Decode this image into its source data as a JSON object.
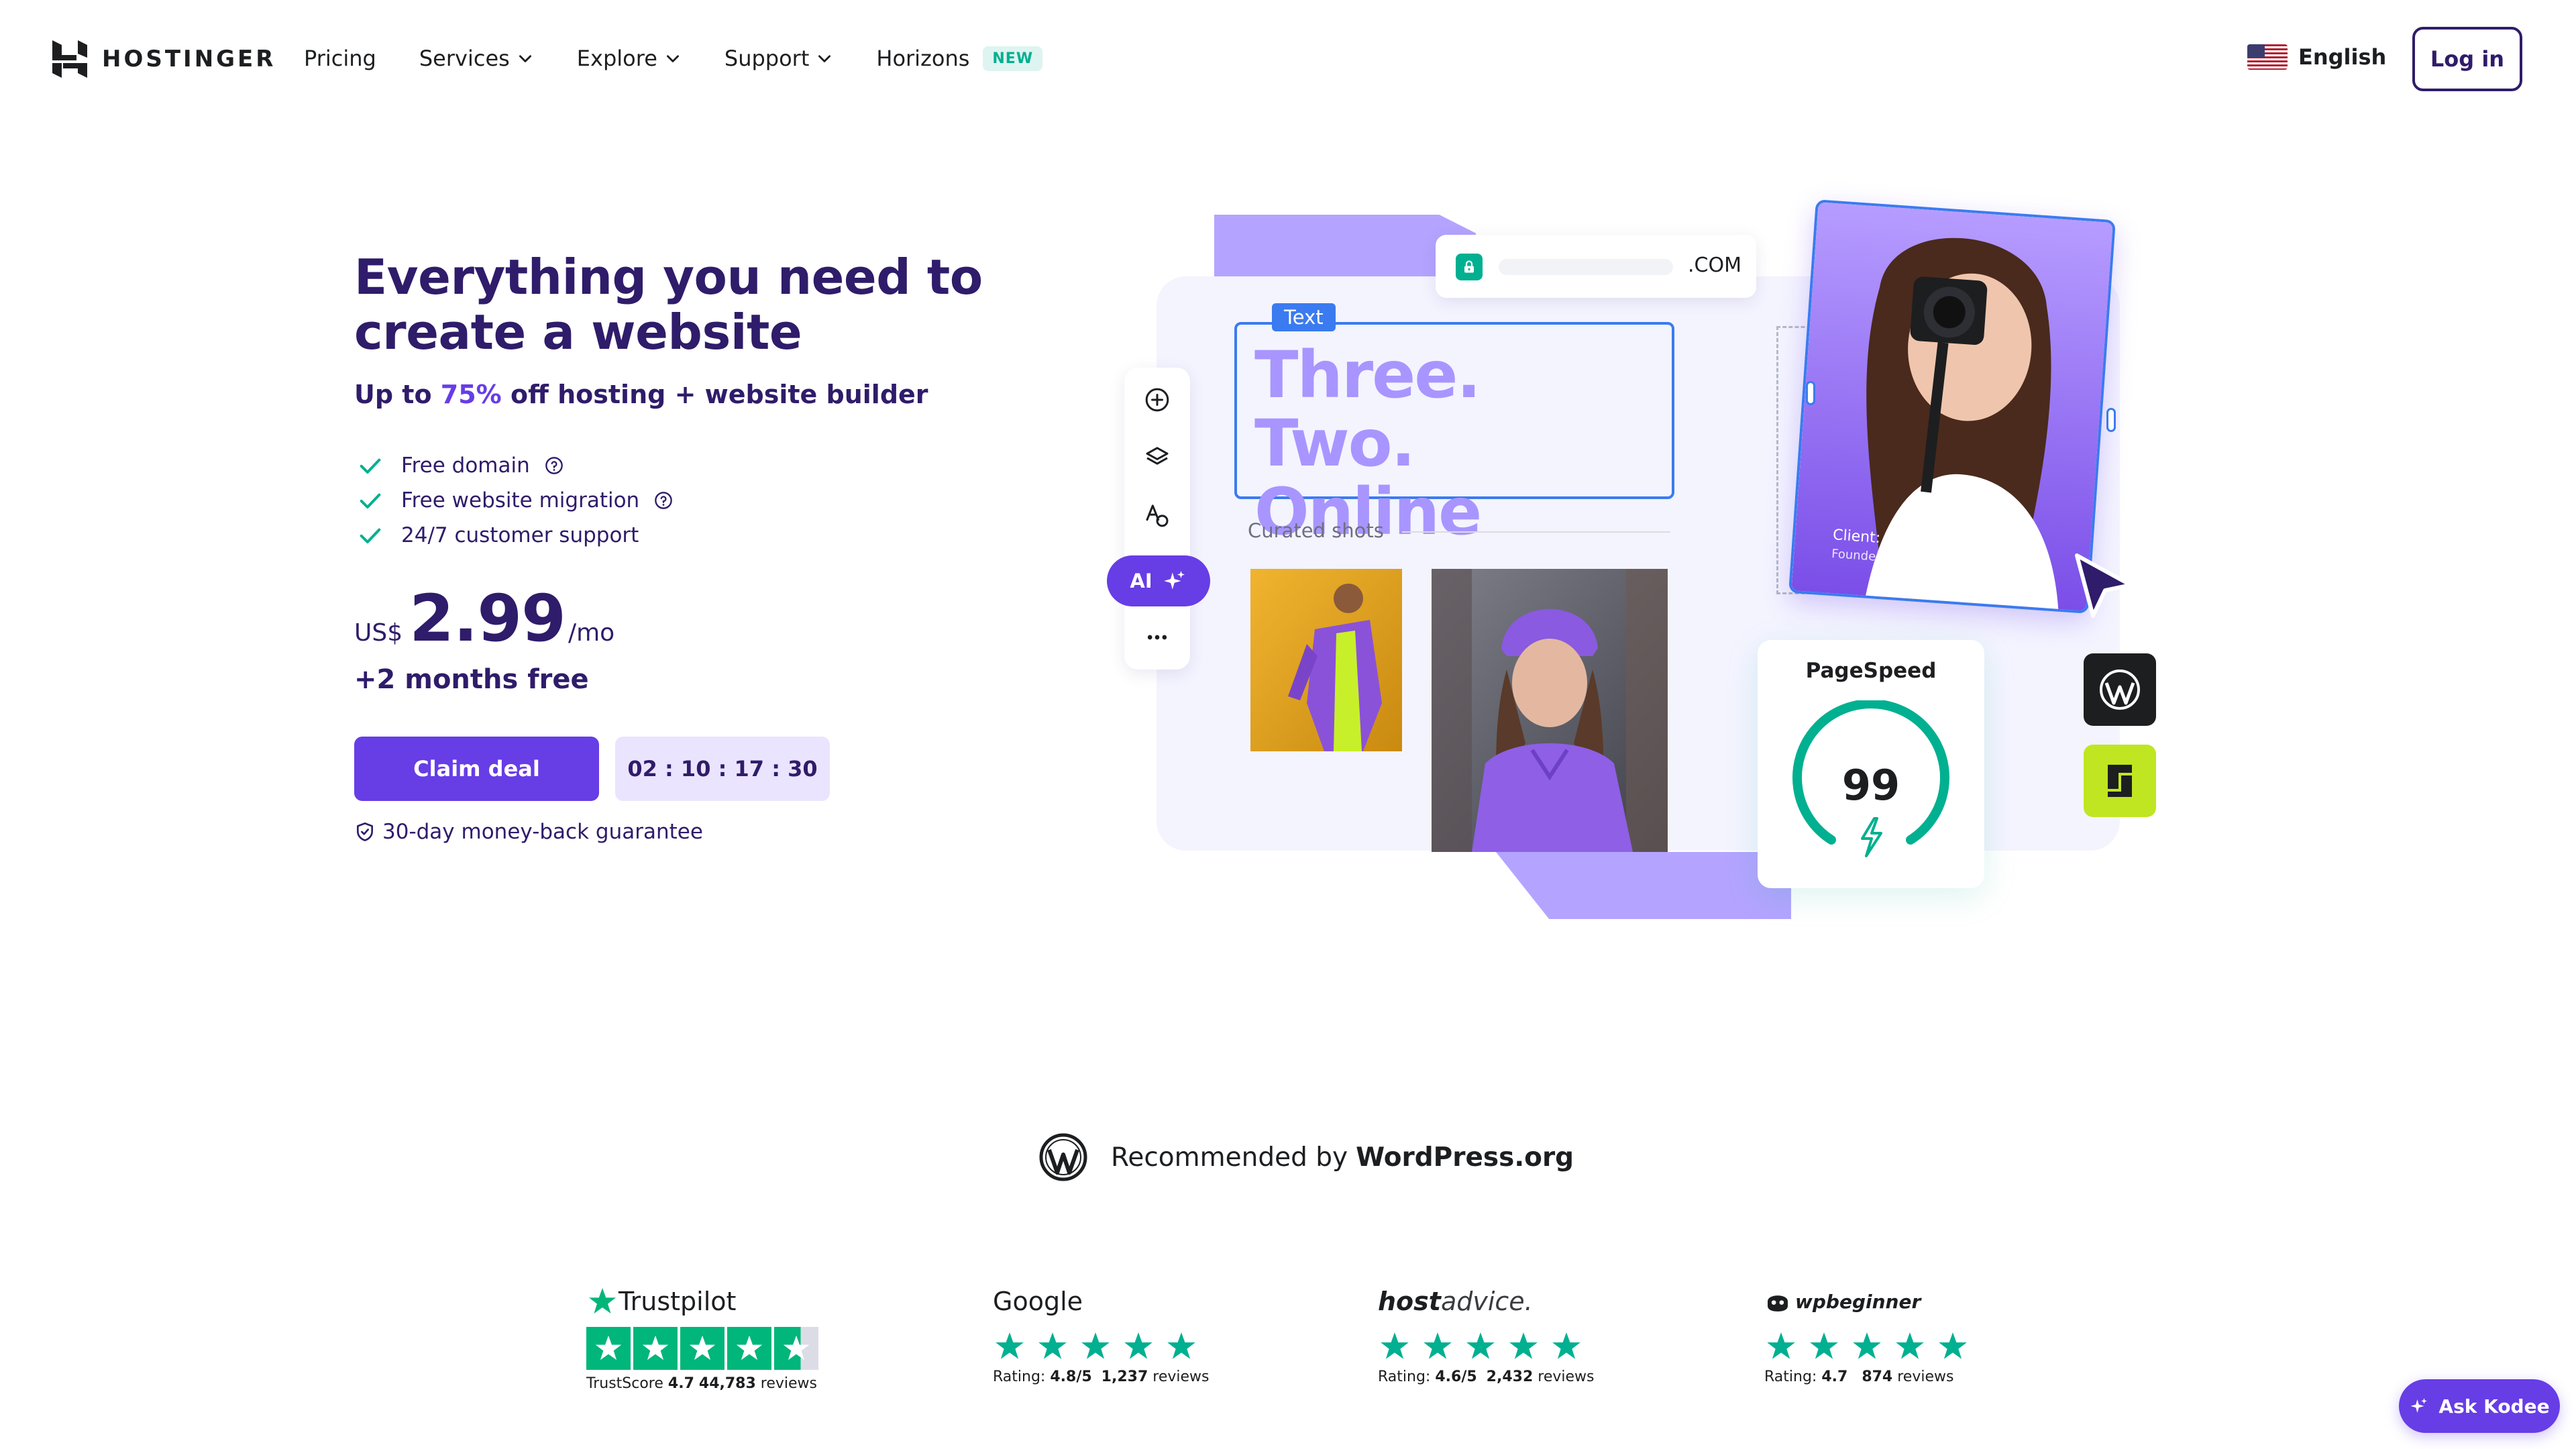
{
  "nav": {
    "brand": "HOSTINGER",
    "links": [
      {
        "label": "Pricing",
        "dropdown": false
      },
      {
        "label": "Services",
        "dropdown": true
      },
      {
        "label": "Explore",
        "dropdown": true
      },
      {
        "label": "Support",
        "dropdown": true
      },
      {
        "label": "Horizons",
        "dropdown": false,
        "badge": "NEW"
      }
    ],
    "language": "English",
    "login": "Log in"
  },
  "hero": {
    "title": "Everything you need to create a website",
    "subtitle_prefix": "Up to ",
    "subtitle_accent": "75%",
    "subtitle_suffix": " off hosting + website builder",
    "features": [
      {
        "label": "Free domain",
        "help": true
      },
      {
        "label": "Free website migration",
        "help": true
      },
      {
        "label": "24/7 customer support",
        "help": false
      }
    ],
    "currency": "US$",
    "price": "2.99",
    "period": "/mo",
    "bonus": "+2 months free",
    "cta": "Claim deal",
    "timer": "02 : 10 : 17 : 30",
    "guarantee": "30-day money-back guarantee"
  },
  "illustration": {
    "domain_tld": ".COM",
    "text_tag": "Text",
    "headline": "Three. Two. Online",
    "curated_label": "Curated shots",
    "ai_label": "AI",
    "portrait_caption": "Client: Anna Franques",
    "portrait_sub": "Founder of annafranques.com",
    "pagespeed_title": "PageSpeed",
    "pagespeed_score": "99",
    "pagespeed_level": 0.99
  },
  "recommended": {
    "prefix": "Recommended by",
    "strong": "WordPress.org"
  },
  "ratings": [
    {
      "source": "Trustpilot",
      "label": "TrustScore",
      "score": "4.7",
      "count": "44,783",
      "unit": "reviews",
      "stars": 4.5
    },
    {
      "source": "Google",
      "label": "Rating:",
      "score": "4.8/5",
      "count": "1,237",
      "unit": "reviews",
      "stars": 5
    },
    {
      "source_bold": "host",
      "source_light": "advice.",
      "label": "Rating:",
      "score": "4.6/5",
      "count": "2,432",
      "unit": "reviews",
      "stars": 5
    },
    {
      "source": "wpbeginner",
      "label": "Rating:",
      "score": "4.7",
      "count": "874",
      "unit": "reviews",
      "stars": 5
    }
  ],
  "chat": {
    "label": "Ask Kodee"
  },
  "colors": {
    "brand": "#673de6",
    "navy": "#2f1c6a",
    "green": "#00b090",
    "trustpilot": "#00b67a",
    "lavender": "#b4a4ff"
  }
}
